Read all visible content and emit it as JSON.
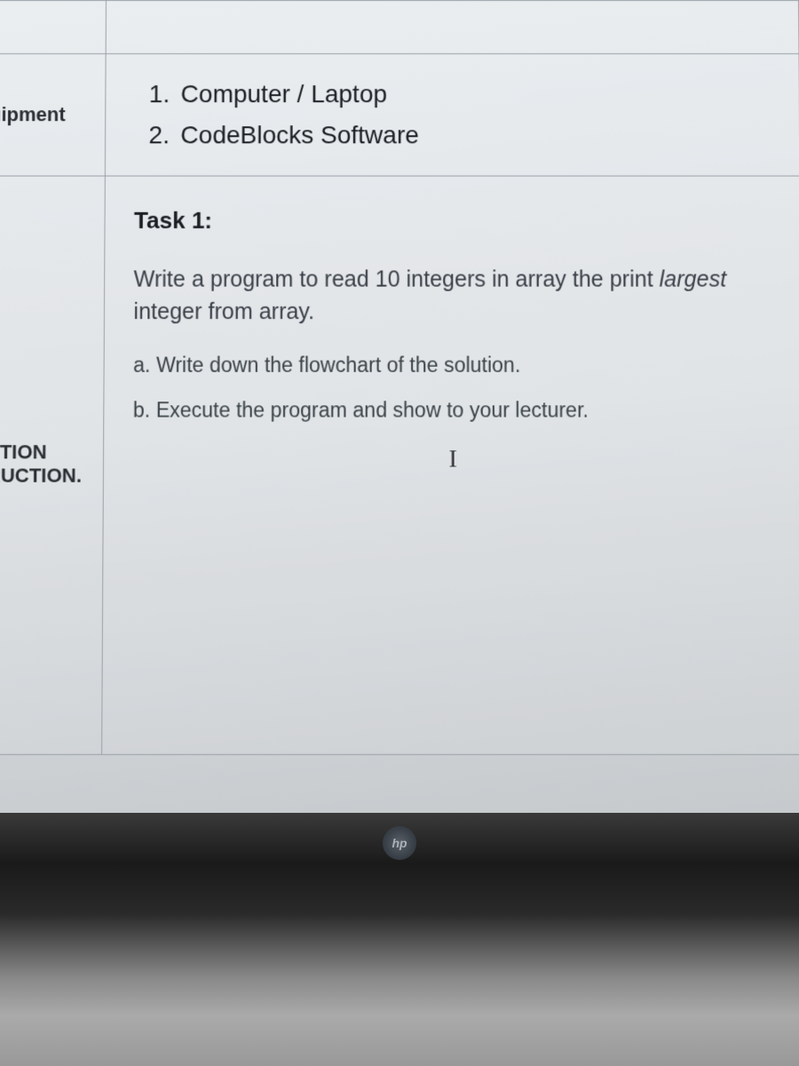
{
  "rows": {
    "equipment": {
      "label": "uipment",
      "items": [
        {
          "num": "1.",
          "text": "Computer / Laptop"
        },
        {
          "num": "2.",
          "text": "CodeBlocks Software"
        }
      ]
    },
    "instruction": {
      "label_line1": "STION",
      "label_line2": "RUCTION.",
      "task_title": "Task 1:",
      "task_body_prefix": "Write a program to read 10 integers in array the print ",
      "task_body_italic": "largest",
      "task_body_suffix": " integer from array.",
      "sub_a": "a. Write down the flowchart of the solution.",
      "sub_b": "b. Execute the program and show to your lecturer.",
      "cursor_glyph": "I"
    }
  },
  "logo_text": "hp"
}
